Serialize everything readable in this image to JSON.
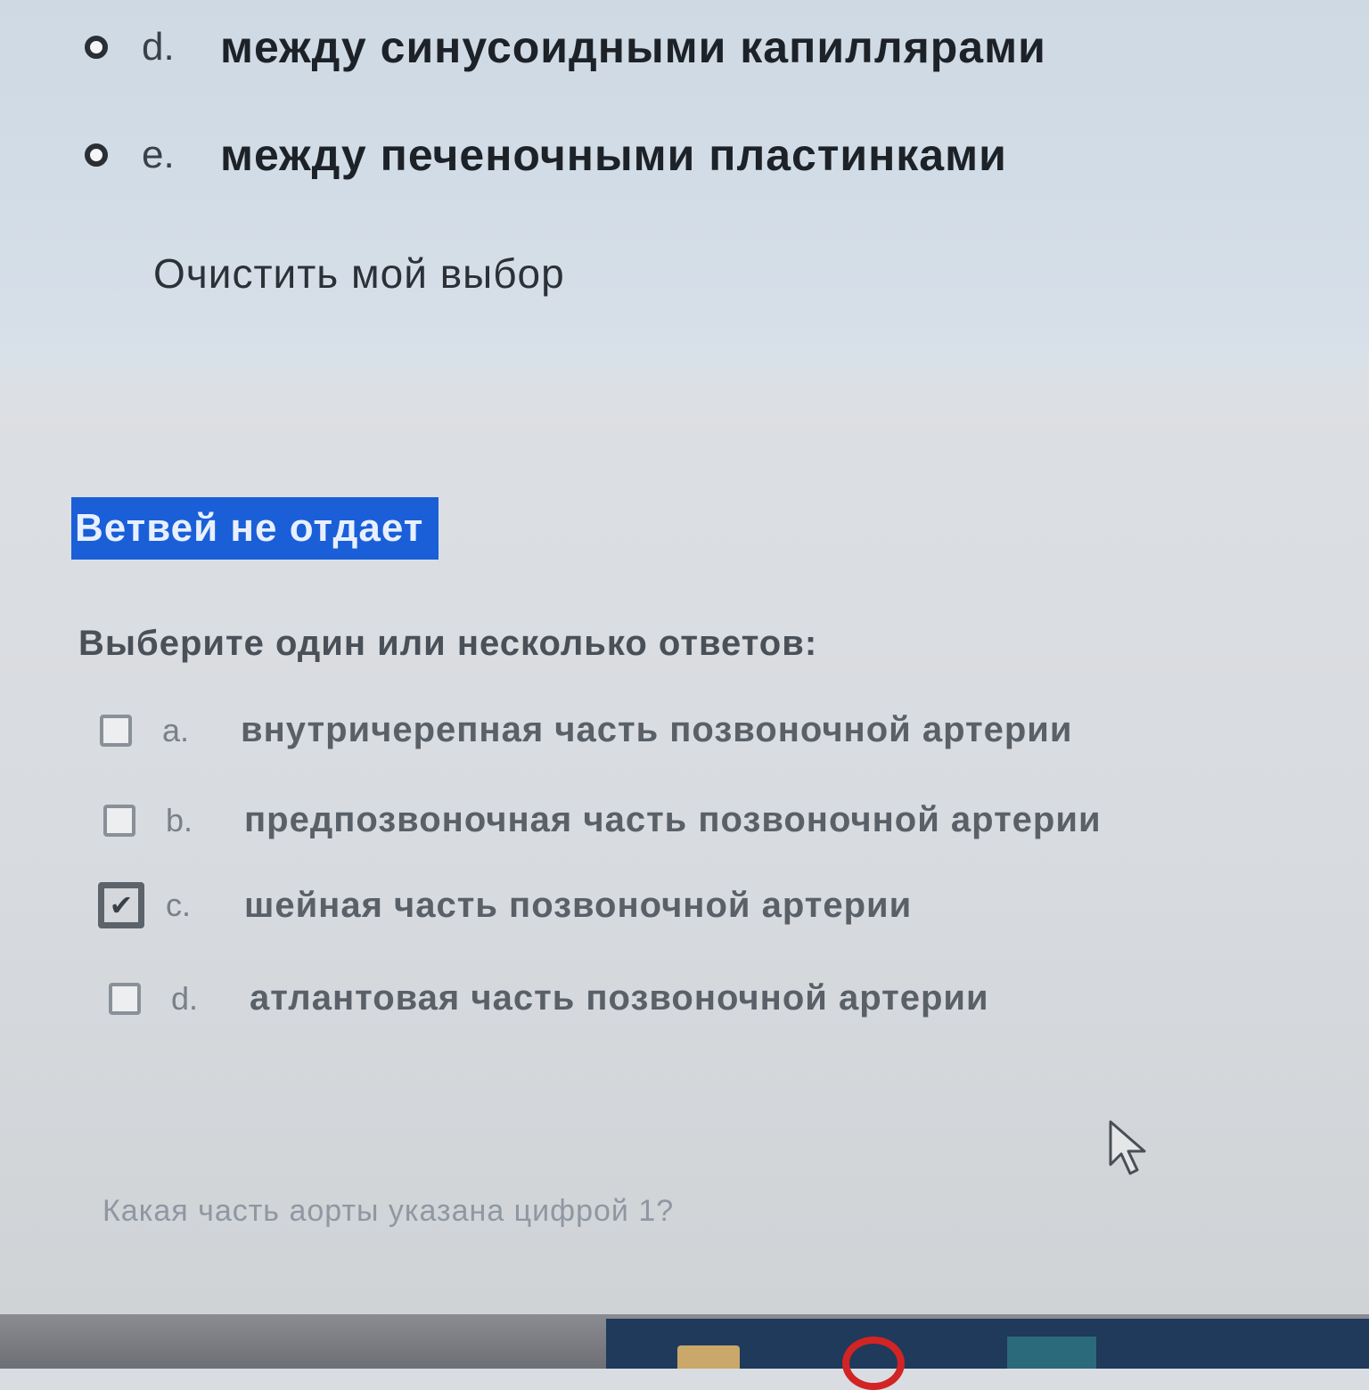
{
  "previous_question": {
    "options": [
      {
        "letter": "d.",
        "text": "между синусоидными капиллярами"
      },
      {
        "letter": "e.",
        "text": "между печеночными пластинками"
      }
    ],
    "clear_choice": "Очистить мой выбор"
  },
  "current_question": {
    "title": "Ветвей не отдает",
    "prompt": "Выберите один или несколько ответов:",
    "options": [
      {
        "letter": "a.",
        "text": "внутричерепная часть позвоночной артерии",
        "checked": false
      },
      {
        "letter": "b.",
        "text": "предпозвоночная часть  позвоночной артерии",
        "checked": false
      },
      {
        "letter": "c.",
        "text": "шейная часть позвоночной артерии",
        "checked": true
      },
      {
        "letter": "d.",
        "text": "атлантовая часть позвоночной артерии",
        "checked": false
      }
    ],
    "checkmark": "✔"
  },
  "next_question": {
    "text": "Какая часть аорты указана цифрой 1?"
  },
  "icons": {
    "cursor": "mouse-pointer-icon",
    "taskbar": [
      "folder-icon",
      "opera-browser-icon",
      "store-icon"
    ]
  },
  "colors": {
    "selection_highlight": "#1a5fd8",
    "taskbar_opera": "#d22424"
  }
}
